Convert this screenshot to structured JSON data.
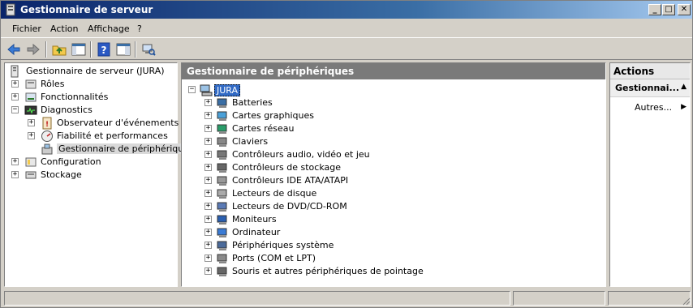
{
  "window": {
    "title": "Gestionnaire de serveur"
  },
  "titlebar_buttons": {
    "minimize": "_",
    "maximize": "□",
    "close": "✕"
  },
  "menu": [
    "Fichier",
    "Action",
    "Affichage",
    "?"
  ],
  "toolbar": {
    "buttons": [
      "back-arrow-icon",
      "forward-arrow-icon",
      "up-folder-icon",
      "show-hide-tree-icon",
      "help-icon",
      "show-hide-action-pane-icon",
      "scan-hardware-icon"
    ]
  },
  "left_tree": {
    "root": "Gestionnaire de serveur (JURA)",
    "items": [
      {
        "label": "Rôles",
        "expander": "+"
      },
      {
        "label": "Fonctionnalités",
        "expander": "+"
      },
      {
        "label": "Diagnostics",
        "expander": "−"
      },
      {
        "label": "Observateur d'événements",
        "expander": "+"
      },
      {
        "label": "Fiabilité et performances",
        "expander": "+"
      },
      {
        "label": "Gestionnaire de périphériques",
        "expander": ""
      },
      {
        "label": "Configuration",
        "expander": "+"
      },
      {
        "label": "Stockage",
        "expander": "+"
      }
    ]
  },
  "center": {
    "header": "Gestionnaire de périphériques",
    "root": {
      "label": "JURA",
      "expander": "−"
    },
    "devices": [
      "Batteries",
      "Cartes graphiques",
      "Cartes réseau",
      "Claviers",
      "Contrôleurs audio, vidéo et jeu",
      "Contrôleurs de stockage",
      "Contrôleurs IDE ATA/ATAPI",
      "Lecteurs de disque",
      "Lecteurs de DVD/CD-ROM",
      "Moniteurs",
      "Ordinateur",
      "Périphériques système",
      "Ports (COM et LPT)",
      "Souris et autres périphériques de pointage"
    ],
    "device_expander": "+"
  },
  "actions": {
    "header": "Actions",
    "section": "Gestionnai...",
    "section_arrow": "▲",
    "items": [
      {
        "label": "Autres...",
        "arrow": "▶"
      }
    ]
  }
}
